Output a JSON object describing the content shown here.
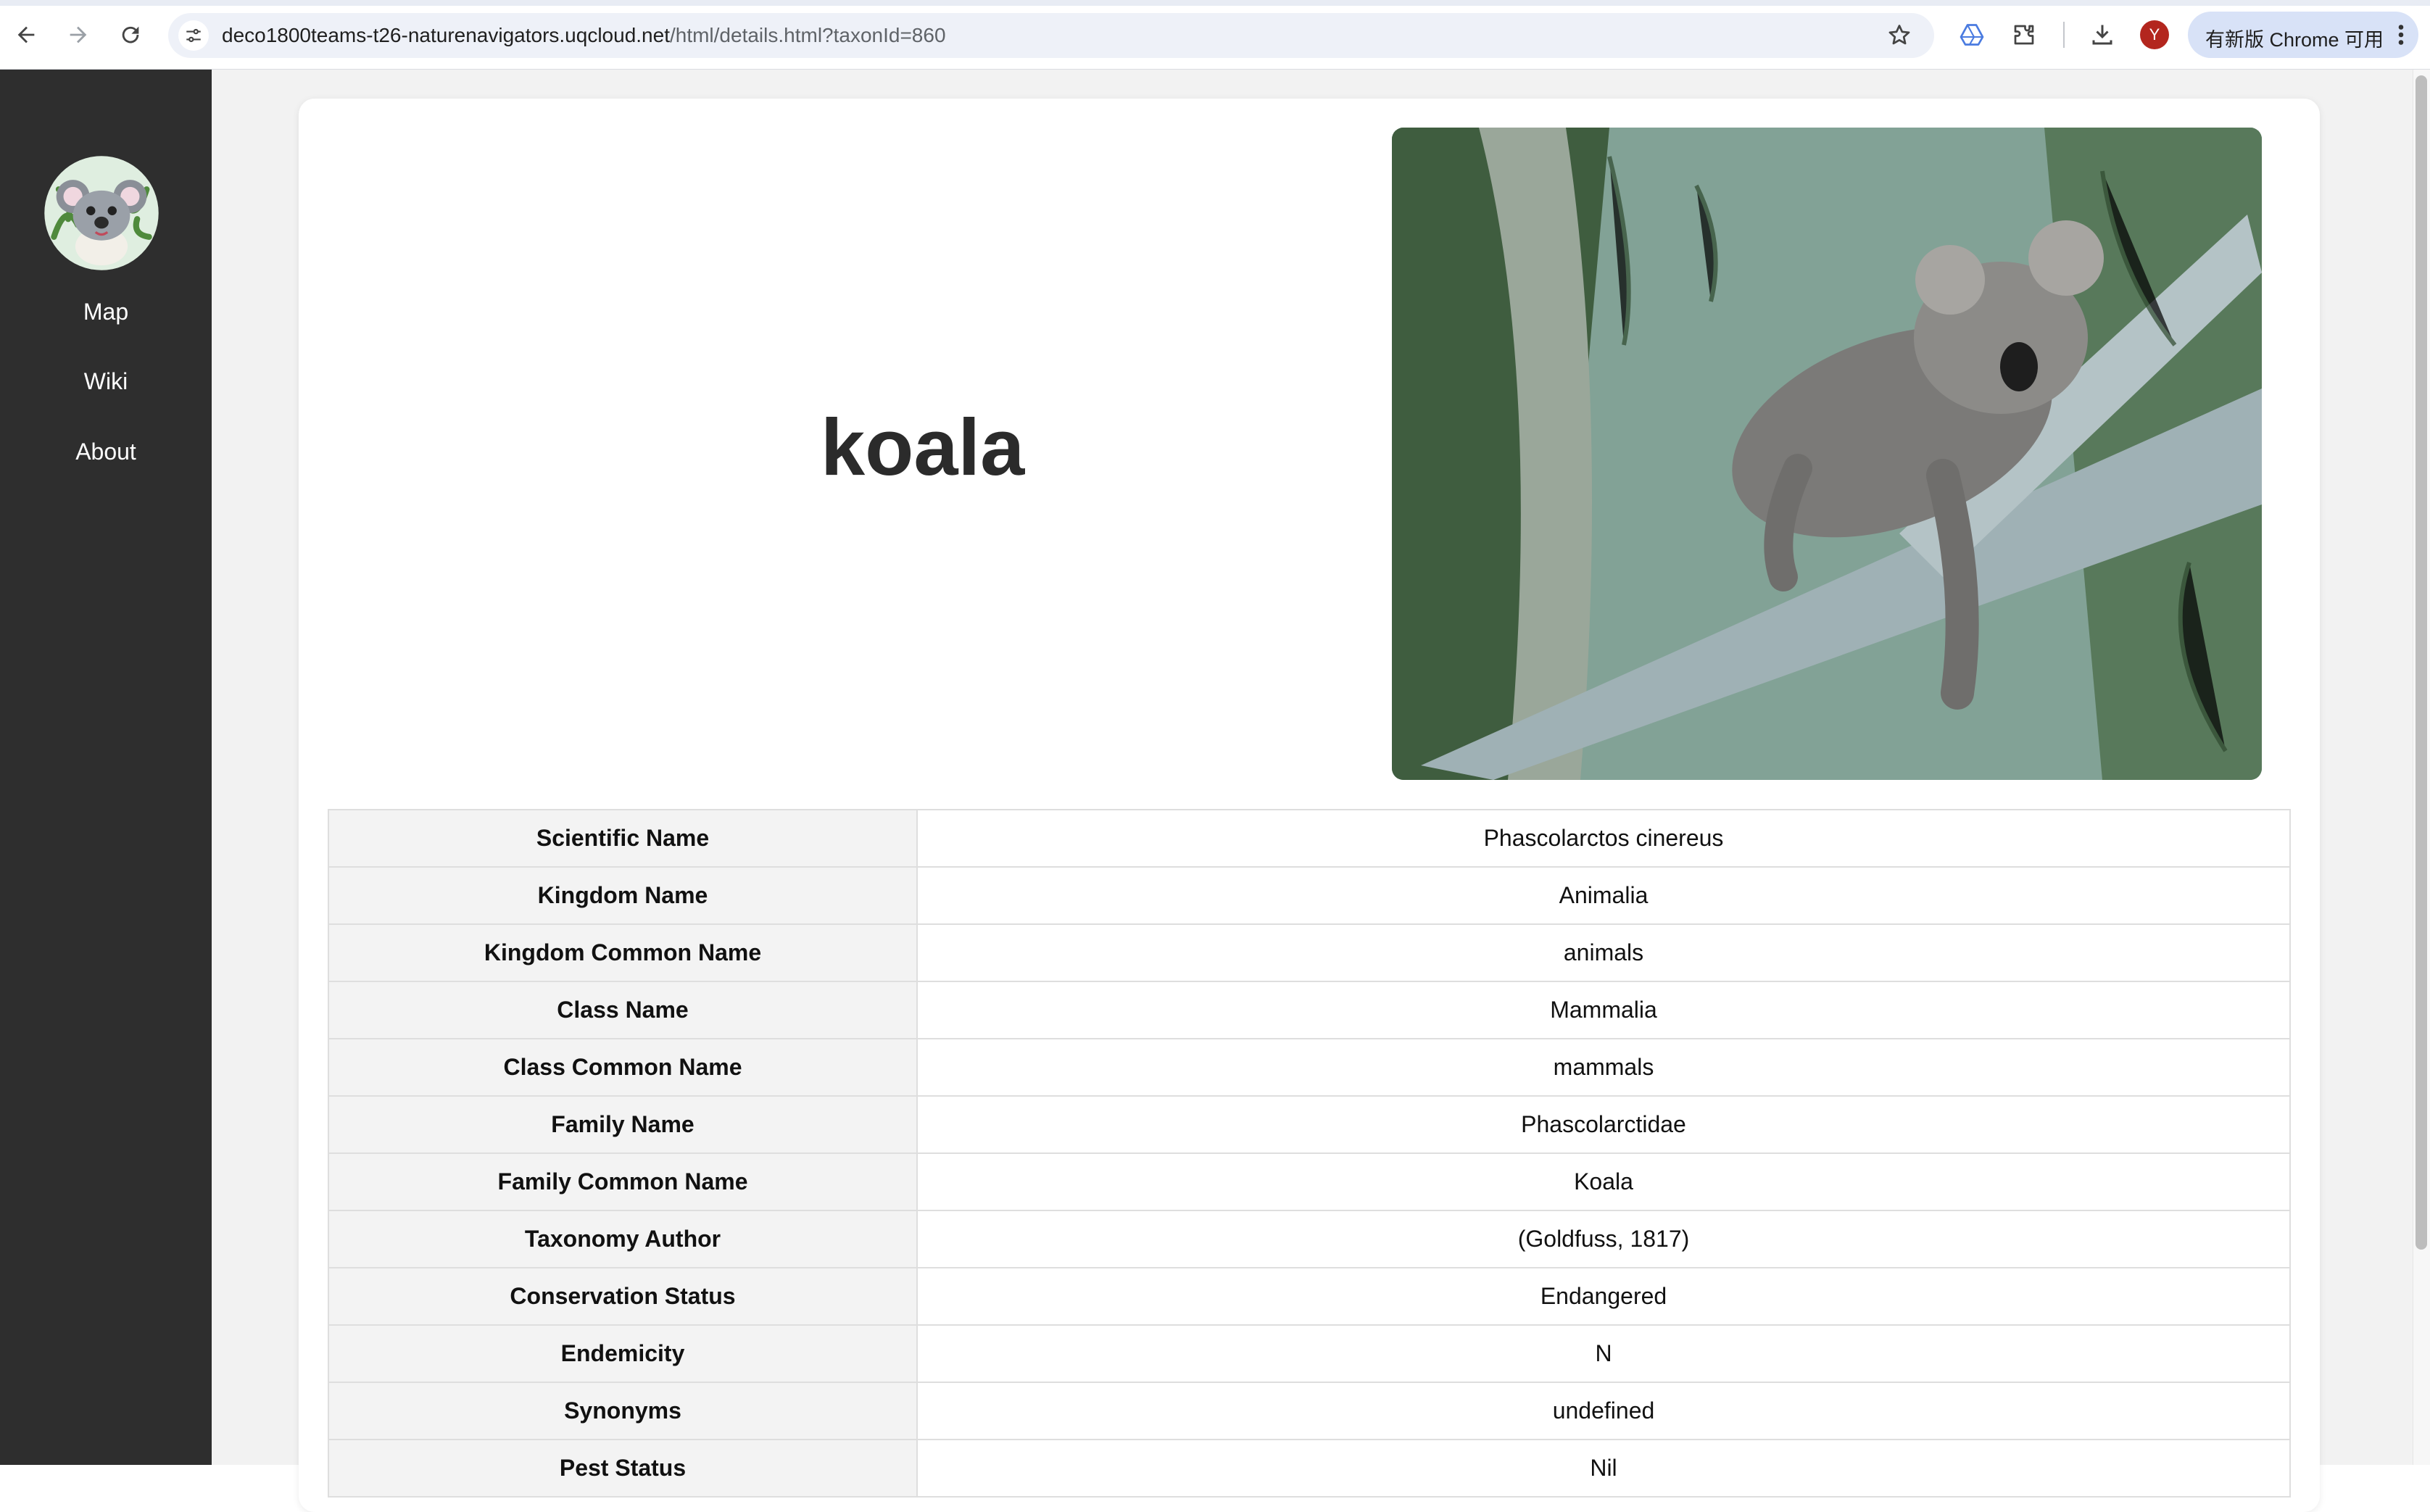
{
  "browser": {
    "url_host": "deco1800teams-t26-naturenavigators.uqcloud.net",
    "url_path": "/html/details.html?taxonId=860",
    "profile_initial": "Y",
    "update_label": "有新版 Chrome 可用",
    "icons": [
      "back-icon",
      "forward-icon",
      "reload-icon",
      "site-settings-icon",
      "bookmark-star-icon",
      "drive-icon",
      "extensions-icon",
      "download-icon",
      "more-menu-icon"
    ]
  },
  "sidebar": {
    "logo_alt": "koala-logo",
    "items": [
      {
        "label": "Map"
      },
      {
        "label": "Wiki"
      },
      {
        "label": "About"
      }
    ]
  },
  "species": {
    "title": "koala",
    "photo": "koala resting on a eucalyptus branch"
  },
  "details": {
    "rows": [
      {
        "key": "Scientific Name",
        "value": "Phascolarctos cinereus"
      },
      {
        "key": "Kingdom Name",
        "value": "Animalia"
      },
      {
        "key": "Kingdom Common Name",
        "value": "animals"
      },
      {
        "key": "Class Name",
        "value": "Mammalia"
      },
      {
        "key": "Class Common Name",
        "value": "mammals"
      },
      {
        "key": "Family Name",
        "value": "Phascolarctidae"
      },
      {
        "key": "Family Common Name",
        "value": "Koala"
      },
      {
        "key": "Taxonomy Author",
        "value": "(Goldfuss, 1817)"
      },
      {
        "key": "Conservation Status",
        "value": "Endangered"
      },
      {
        "key": "Endemicity",
        "value": "N"
      },
      {
        "key": "Synonyms",
        "value": "undefined"
      },
      {
        "key": "Pest Status",
        "value": "Nil"
      }
    ]
  },
  "colors": {
    "sidebar_bg": "#2e2e2e",
    "page_bg": "#f2f2f2",
    "card_bg": "#ffffff",
    "key_cell_bg": "#f3f3f3"
  }
}
